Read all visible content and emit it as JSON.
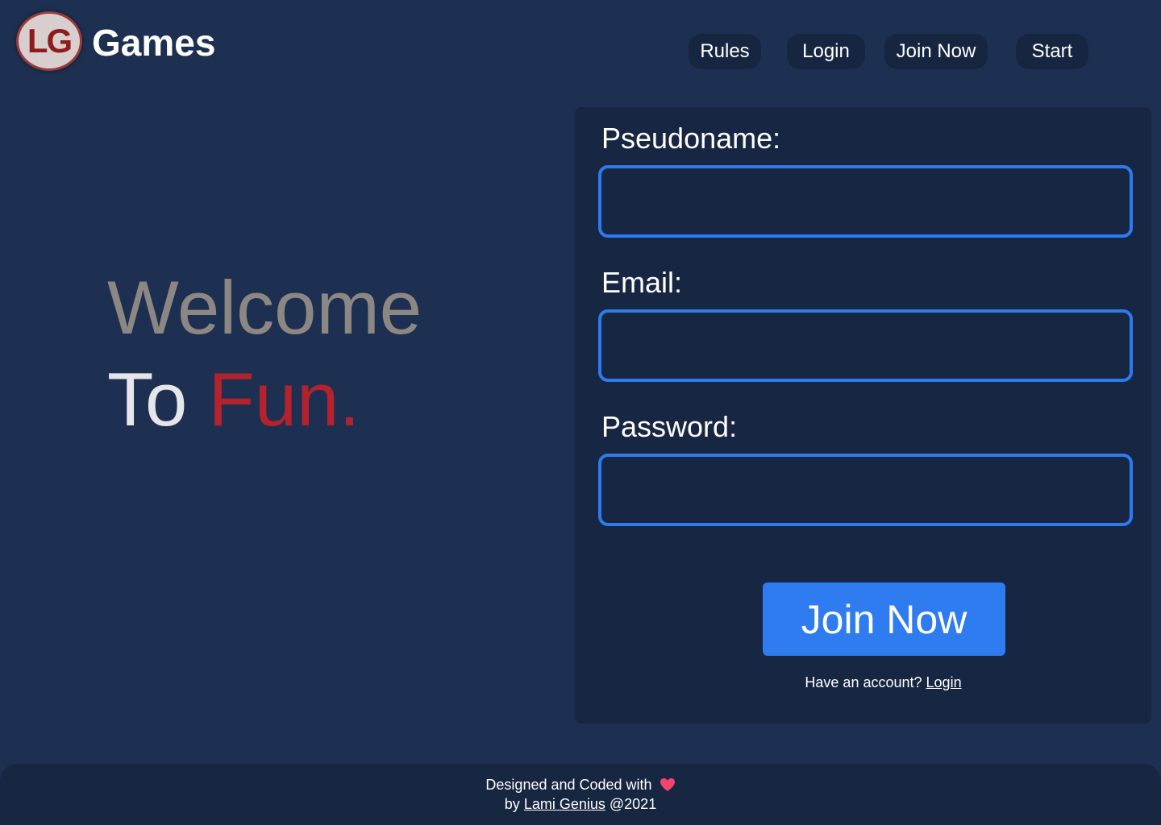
{
  "header": {
    "logo_text": "LG",
    "brand_name": "Games"
  },
  "nav": {
    "rules": "Rules",
    "login": "Login",
    "join_now": "Join Now",
    "start": "Start"
  },
  "hero": {
    "line1": "Welcome",
    "line2_to": "To",
    "line2_fun": "Fun."
  },
  "form": {
    "pseudoname_label": "Pseudoname:",
    "email_label": "Email:",
    "password_label": "Password:",
    "pseudoname_value": "",
    "email_value": "",
    "password_value": "",
    "submit_label": "Join Now",
    "account_prompt": "Have an account?",
    "account_link": "Login"
  },
  "footer": {
    "line1": "Designed and Coded with",
    "line2_prefix": "by",
    "author": "Lami Genius",
    "line2_suffix": "@2021",
    "heart_icon": "heart-icon"
  },
  "colors": {
    "background": "#1e3052",
    "panel": "#172642",
    "accent_blue": "#2e7cf0",
    "fun_red": "#b3222d",
    "welcome_gray": "#8d8784",
    "heart_pink": "#f0466e"
  }
}
